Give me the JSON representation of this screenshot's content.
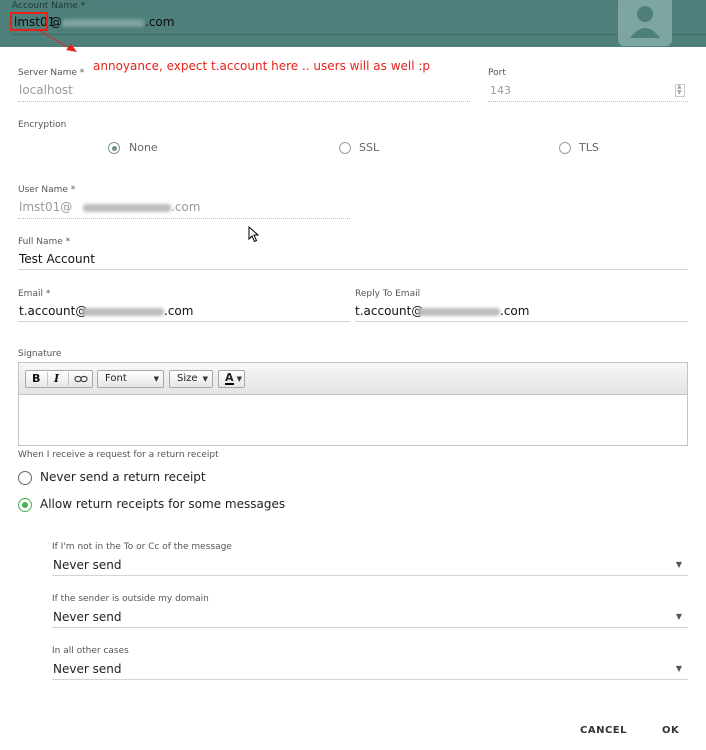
{
  "header": {
    "account_label": "Account Name *",
    "account_prefix": "lmst01",
    "account_at": "@",
    "account_suffix": ".com",
    "bg_color": "#4e7f7a"
  },
  "annotation": {
    "text": "annoyance, expect t.account here .. users will as well :p",
    "color": "#e8221b"
  },
  "server": {
    "label": "Server Name *",
    "value": "localhost",
    "port_label": "Port",
    "port_value": "143"
  },
  "encryption": {
    "label": "Encryption",
    "options": [
      "None",
      "SSL",
      "TLS"
    ],
    "selected": "None"
  },
  "user": {
    "label": "User Name *",
    "prefix": "lmst01@",
    "suffix": ".com"
  },
  "full_name": {
    "label": "Full Name *",
    "value": "Test Account"
  },
  "email": {
    "label": "Email *",
    "prefix": "t.account@",
    "suffix": ".com",
    "reply_label": "Reply To Email",
    "reply_prefix": "t.account@",
    "reply_suffix": ".com"
  },
  "signature": {
    "label": "Signature",
    "bold": "B",
    "italic": "I",
    "font": "Font",
    "size": "Size",
    "color_a": "A"
  },
  "receipts": {
    "label": "When I receive a request for a return receipt",
    "options": [
      "Never send a return receipt",
      "Allow return receipts for some messages"
    ],
    "selected_index": 1,
    "rules": [
      {
        "label": "If I'm not in the To or Cc of the message",
        "value": "Never send"
      },
      {
        "label": "If the sender is outside my domain",
        "value": "Never send"
      },
      {
        "label": "In all other cases",
        "value": "Never send"
      }
    ]
  },
  "footer": {
    "cancel": "CANCEL",
    "ok": "OK"
  }
}
